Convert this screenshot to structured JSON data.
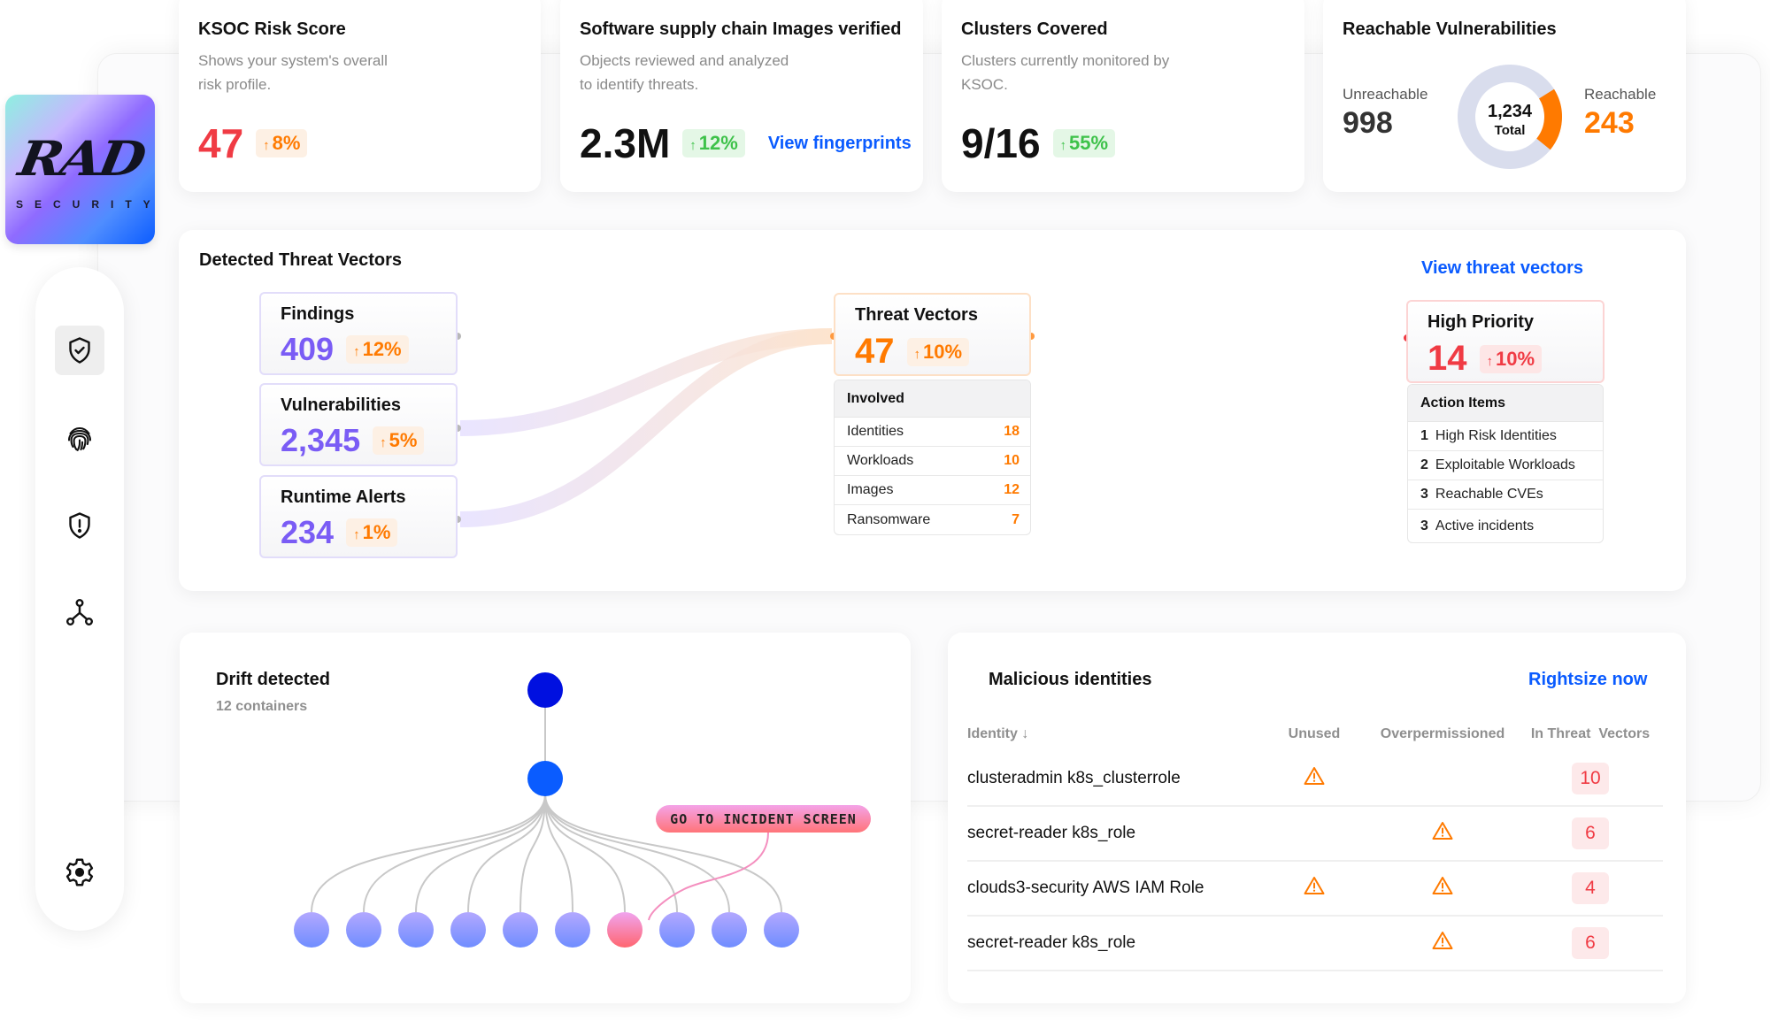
{
  "brand": {
    "logo_text": "RAD",
    "logo_subtext": "SECURITY"
  },
  "sidebar": {
    "items": [
      {
        "icon": "shield-check-icon",
        "active": true
      },
      {
        "icon": "fingerprint-icon",
        "active": false
      },
      {
        "icon": "shield-alert-icon",
        "active": false
      },
      {
        "icon": "network-icon",
        "active": false
      },
      {
        "icon": "gear-icon",
        "active": false
      }
    ]
  },
  "kpis": {
    "risk": {
      "title": "KSOC Risk Score",
      "subtitle": "Shows your system's overall risk profile.",
      "value": "47",
      "change": "8%"
    },
    "supply": {
      "title": "Software supply chain Images verified",
      "subtitle": "Objects reviewed and analyzed to identify threats.",
      "value": "2.3M",
      "change": "12%",
      "link": "View fingerprints"
    },
    "clusters": {
      "title": "Clusters Covered",
      "subtitle": "Clusters currently monitored by KSOC.",
      "value": "9/16",
      "change": "55%"
    },
    "reachable": {
      "title": "Reachable Vulnerabilities",
      "unreachable_label": "Unreachable",
      "unreachable_value": "998",
      "reachable_label": "Reachable",
      "reachable_value": "243",
      "total_value": "1,234",
      "total_label": "Total",
      "reachable_fraction": 0.197
    }
  },
  "threats": {
    "title": "Detected Threat Vectors",
    "link": "View threat vectors",
    "sources": [
      {
        "label": "Findings",
        "value": "409",
        "change": "12%"
      },
      {
        "label": "Vulnerabilities",
        "value": "2,345",
        "change": "5%"
      },
      {
        "label": "Runtime Alerts",
        "value": "234",
        "change": "1%"
      }
    ],
    "vectors": {
      "label": "Threat Vectors",
      "value": "47",
      "change": "10%",
      "involved_title": "Involved",
      "involved": [
        {
          "label": "Identities",
          "count": "18"
        },
        {
          "label": "Workloads",
          "count": "10"
        },
        {
          "label": "Images",
          "count": "12"
        },
        {
          "label": "Ransomware",
          "count": "7"
        }
      ]
    },
    "priority": {
      "label": "High Priority",
      "value": "14",
      "change": "10%",
      "actions_title": "Action Items",
      "actions": [
        {
          "num": "1",
          "label": "High Risk Identities"
        },
        {
          "num": "2",
          "label": "Exploitable Workloads"
        },
        {
          "num": "3",
          "label": "Reachable CVEs"
        },
        {
          "num": "3",
          "label": "Active incidents"
        }
      ]
    }
  },
  "drift": {
    "title": "Drift detected",
    "subtitle": "12 containers",
    "button": "GO TO INCIDENT SCREEN",
    "leaf_count": 10,
    "incident_leaf_index": 6
  },
  "identities": {
    "title": "Malicious identities",
    "link": "Rightsize now",
    "columns": [
      "Identity ↓",
      "Unused",
      "Overpermissioned",
      "In Threat  Vectors"
    ],
    "rows": [
      {
        "name": "clusteradmin k8s_clusterrole",
        "unused": true,
        "overpermissioned": false,
        "count": "10"
      },
      {
        "name": "secret-reader k8s_role",
        "unused": false,
        "overpermissioned": true,
        "count": "6"
      },
      {
        "name": "clouds3-security AWS IAM Role",
        "unused": true,
        "overpermissioned": true,
        "count": "4"
      },
      {
        "name": "secret-reader k8s_role",
        "unused": false,
        "overpermissioned": true,
        "count": "6"
      }
    ]
  }
}
